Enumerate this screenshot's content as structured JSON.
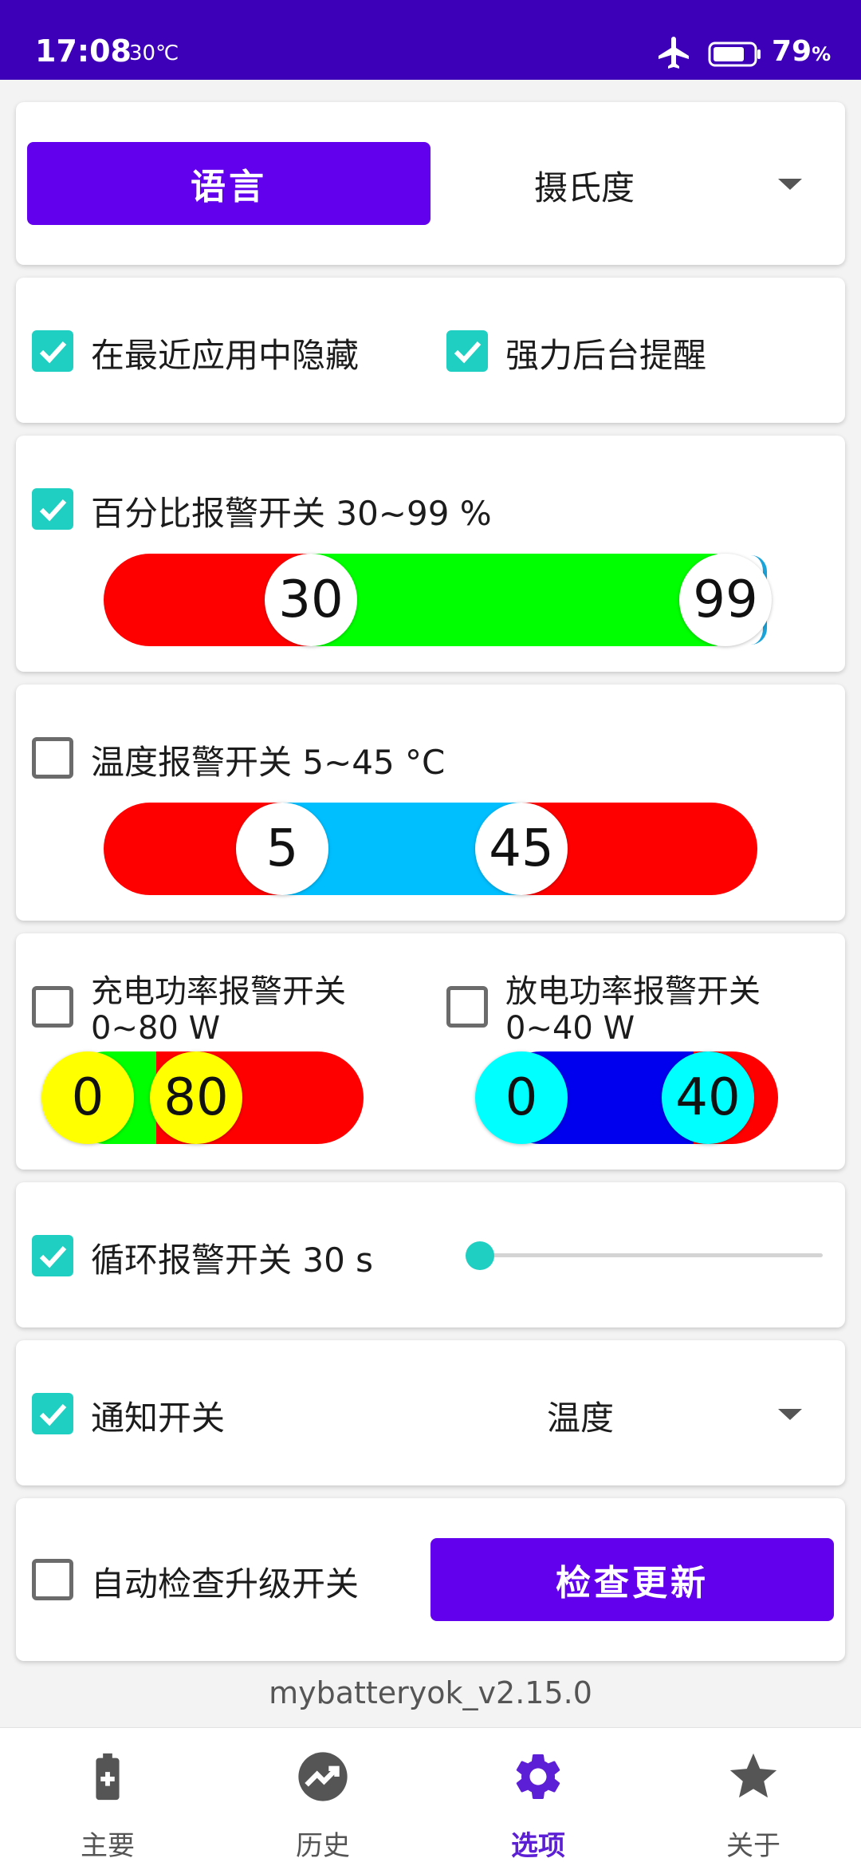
{
  "status_bar": {
    "time": "17:08",
    "temperature": "30℃",
    "battery_percent": "79",
    "battery_unit": "%"
  },
  "language_card": {
    "language_button": "语言",
    "unit_select_value": "摄氏度"
  },
  "options_card": {
    "hide_recents_label": "在最近应用中隐藏",
    "hide_recents_checked": true,
    "force_background_label": "强力后台提醒",
    "force_background_checked": true
  },
  "percent_alarm": {
    "label": "百分比报警开关 30~99 %",
    "checked": true,
    "low": "30",
    "high": "99",
    "low_value": 30,
    "high_value": 99,
    "min": 0,
    "max": 100,
    "colors": {
      "outside": "#ff0000",
      "inside": "#00ff00"
    }
  },
  "temp_alarm": {
    "label": "温度报警开关 5~45 °C",
    "checked": false,
    "low": "5",
    "high": "45",
    "colors": {
      "outside": "#ff0000",
      "inside": "#00bfff"
    }
  },
  "charge_alarm": {
    "label_line1": "充电功率报警开关",
    "label_line2": "0~80 W",
    "checked": false,
    "low": "0",
    "high": "80",
    "colors": {
      "thumb": "#ffff00",
      "inside": "#00ff00",
      "outside": "#ff0000"
    }
  },
  "discharge_alarm": {
    "label_line1": "放电功率报警开关",
    "label_line2": "0~40 W",
    "checked": false,
    "low": "0",
    "high": "40",
    "colors": {
      "thumb": "#00ffff",
      "inside": "#0000ff",
      "outside": "#ff0000"
    }
  },
  "loop_alarm": {
    "label": "循环报警开关 30 s",
    "checked": true,
    "seek_fraction": 0.0
  },
  "notification": {
    "label": "通知开关",
    "checked": true,
    "select_value": "温度"
  },
  "update": {
    "auto_check_label": "自动检查升级开关",
    "auto_check_checked": false,
    "check_button": "检查更新"
  },
  "version": "mybatteryok_v2.15.0",
  "bottom_nav": [
    {
      "label": "主要",
      "icon": "battery-icon",
      "active": false
    },
    {
      "label": "历史",
      "icon": "chart-icon",
      "active": false
    },
    {
      "label": "选项",
      "icon": "gear-icon",
      "active": true
    },
    {
      "label": "关于",
      "icon": "star-icon",
      "active": false
    }
  ],
  "colors": {
    "status_bar": "#3d00b8",
    "accent": "#6200ee",
    "checkbox": "#1fcfc1",
    "nav_active": "#5c1fd6"
  }
}
